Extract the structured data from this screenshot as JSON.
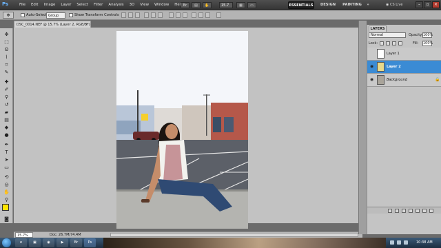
{
  "app": {
    "logo": "Ps",
    "menus": [
      "File",
      "Edit",
      "Image",
      "Layer",
      "Select",
      "Filter",
      "Analysis",
      "3D",
      "View",
      "Window",
      "Help"
    ],
    "zoom_value": "15.7",
    "workspaces": {
      "essentials": "ESSENTIALS",
      "design": "DESIGN",
      "painting": "PAINTING",
      "more": "»"
    },
    "cslive": "CS Live"
  },
  "options_bar": {
    "auto_select_label": "Auto-Select:",
    "auto_select_checked": false,
    "auto_select_target": "Group",
    "show_transform_label": "Show Transform Controls",
    "show_transform_checked": false
  },
  "document": {
    "tab_title": "DSC_0014.NEF @ 15.7% (Layer 2, RGB/8*) *",
    "close_glyph": "×",
    "zoom_status": "15.7%",
    "doc_size": "Doc: 26.7M/74.4M"
  },
  "layers_panel": {
    "tab_label": "LAYERS",
    "blend_mode": "Normal",
    "opacity_label": "Opacity:",
    "opacity_value": "100%",
    "lock_label": "Lock:",
    "fill_label": "Fill:",
    "fill_value": "100%",
    "layers": [
      {
        "name": "Layer 1",
        "visible": false,
        "selected": false
      },
      {
        "name": "Layer 2",
        "visible": true,
        "selected": true
      },
      {
        "name": "Background",
        "visible": true,
        "selected": false,
        "locked": true
      }
    ]
  },
  "taskbar": {
    "time": "10:38 AM"
  },
  "colors": {
    "foreground": "#ffe400",
    "background": "#ffffff",
    "selection": "#3b8bd4"
  }
}
